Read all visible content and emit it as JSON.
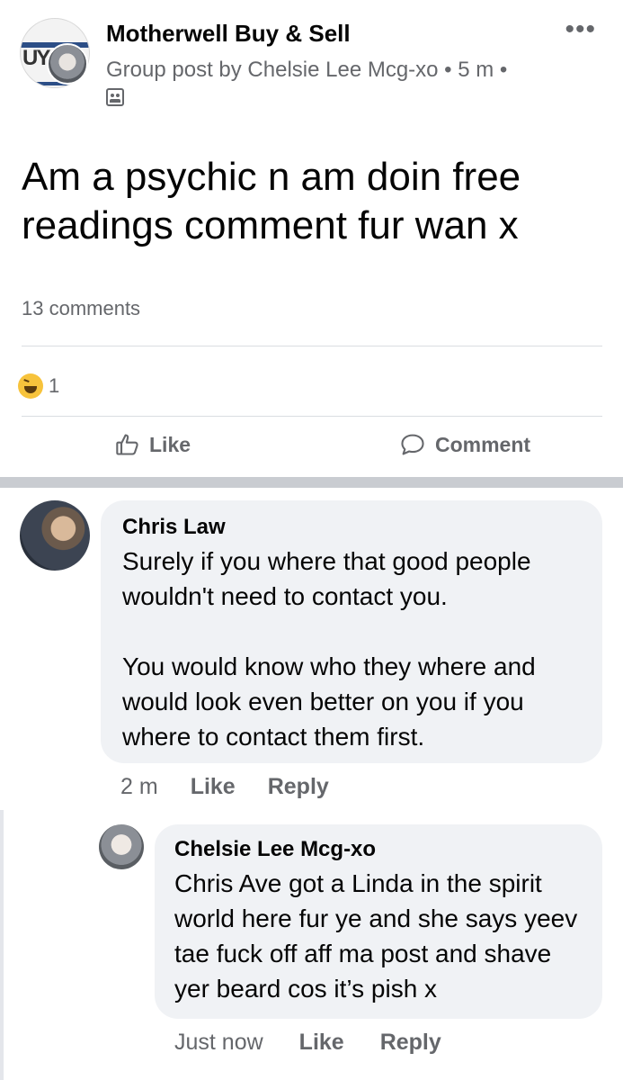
{
  "post": {
    "group_name": "Motherwell Buy & Sell",
    "meta": "Group post by Chelsie Lee Mcg-xo • 5 m •",
    "avatar_letters": "UY",
    "body": "Am a psychic n am doin free readings comment fur wan x",
    "comments_count": "13 comments",
    "reaction_count": "1",
    "like_label": "Like",
    "comment_label": "Comment"
  },
  "comments": [
    {
      "author": "Chris Law",
      "paragraphs": [
        "Surely if you where that good people wouldn't need to contact you.",
        "You would know who they where and would look even better on you if you where to contact them first."
      ],
      "time": "2 m",
      "like": "Like",
      "reply": "Reply"
    }
  ],
  "reply": {
    "author": "Chelsie Lee Mcg-xo",
    "text": "Chris Ave got a Linda in the spirit world here fur ye and she says yeev tae fuck off aff ma post and shave yer beard cos it’s pish x",
    "time": "Just now",
    "like": "Like",
    "reply": "Reply"
  },
  "colors": {
    "secondary_text": "#65676b",
    "bubble": "#f0f2f5",
    "separator": "#c9ccd1"
  },
  "icons": [
    "more-icon",
    "privacy-icon",
    "haha-reaction-icon",
    "like-icon",
    "comment-icon"
  ]
}
